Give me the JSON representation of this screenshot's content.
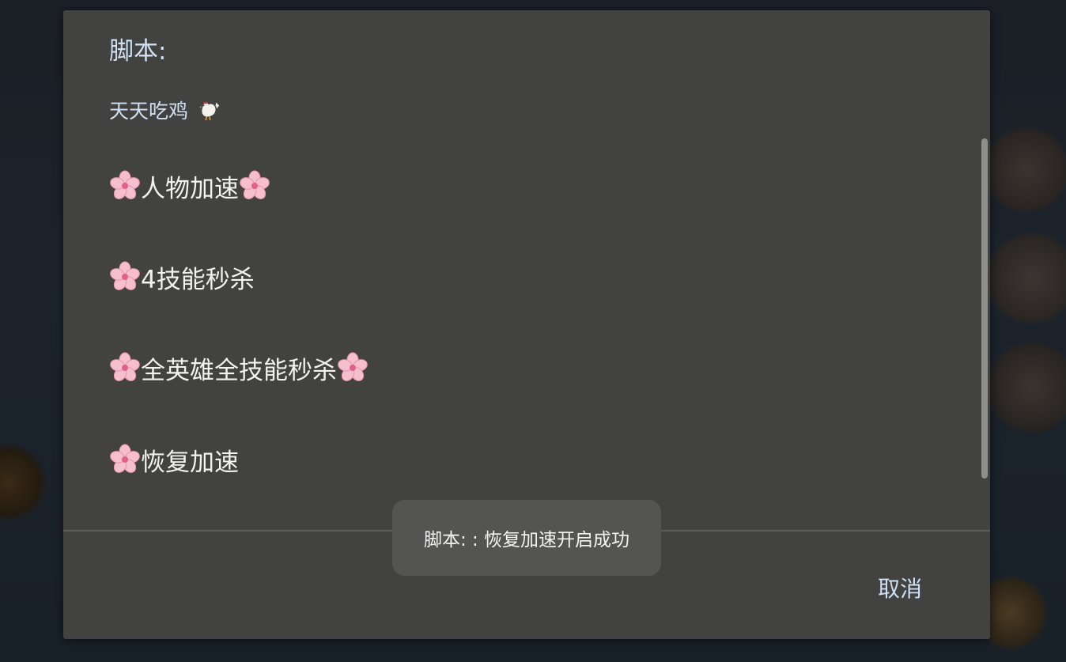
{
  "dialog": {
    "title": "脚本:",
    "message": "天天吃鸡",
    "message_icon": "hen-icon",
    "items": [
      {
        "label": "人物加速",
        "leading_icon": "cherry-blossom-icon",
        "trailing_icon": "cherry-blossom-icon"
      },
      {
        "label": "4技能秒杀",
        "leading_icon": "cherry-blossom-icon",
        "trailing_icon": ""
      },
      {
        "label": "全英雄全技能秒杀",
        "leading_icon": "cherry-blossom-icon",
        "trailing_icon": "cherry-blossom-icon"
      },
      {
        "label": "恢复加速",
        "leading_icon": "cherry-blossom-icon",
        "trailing_icon": ""
      }
    ],
    "cancel_label": "取消"
  },
  "toast": {
    "text": "脚本: : 恢复加速开启成功"
  },
  "colors": {
    "dialog_bg": "#424341",
    "accent_text": "#cfe0f2",
    "item_text": "#f2f2f2",
    "toast_bg": "#545553"
  }
}
